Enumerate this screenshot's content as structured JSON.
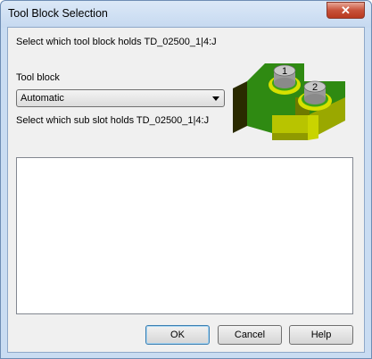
{
  "window": {
    "title": "Tool Block Selection",
    "close_label": "✕"
  },
  "prompt_block": "Select which tool block holds TD_02500_1|4:J",
  "tool_block": {
    "label": "Tool block",
    "selected": "Automatic"
  },
  "prompt_subslot": "Select which sub slot holds TD_02500_1|4:J",
  "preview": {
    "slot_1": "1",
    "slot_2": "2"
  },
  "buttons": {
    "ok": "OK",
    "cancel": "Cancel",
    "help": "Help"
  }
}
